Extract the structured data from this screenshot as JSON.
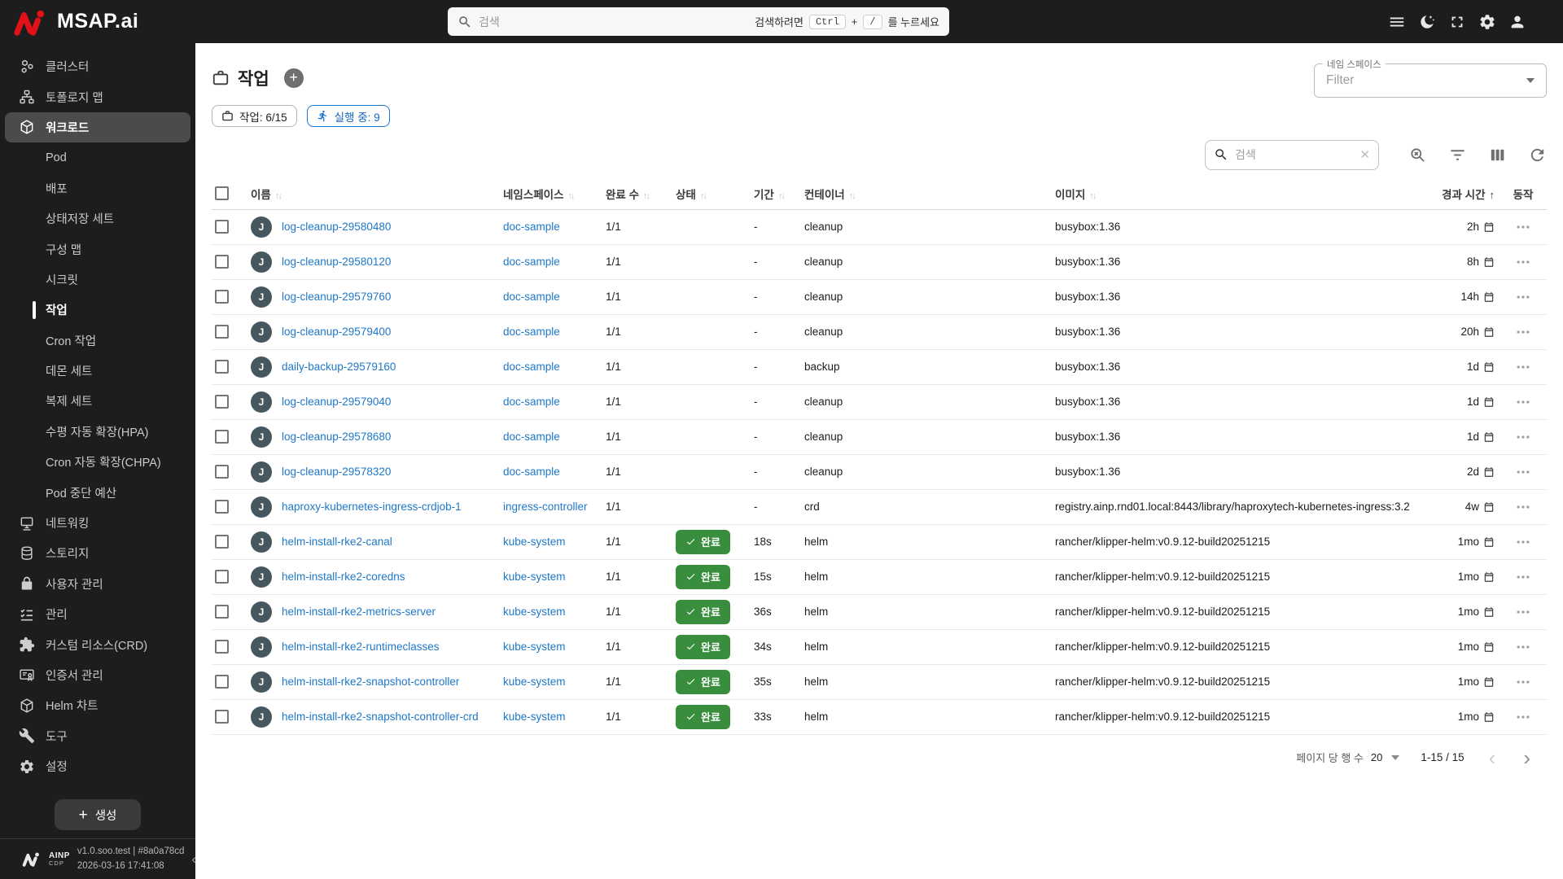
{
  "topbar": {
    "brand": "MSAP.ai",
    "search": {
      "placeholder": "검색",
      "hint_prefix": "검색하려면",
      "key1": "Ctrl",
      "key_join": "+",
      "key2": "/",
      "hint_suffix": "를 누르세요"
    },
    "actions": [
      {
        "id": "menu",
        "icon": "menu-icon"
      },
      {
        "id": "dark-mode",
        "icon": "moon-icon"
      },
      {
        "id": "fullscreen",
        "icon": "fullscreen-icon"
      },
      {
        "id": "settings",
        "icon": "gear-icon"
      },
      {
        "id": "account",
        "icon": "person-icon"
      }
    ]
  },
  "sidebar": {
    "items": [
      {
        "id": "cluster",
        "label": "클러스터",
        "icon": "cluster"
      },
      {
        "id": "topology-map",
        "label": "토폴로지 맵",
        "icon": "topology"
      },
      {
        "id": "workload",
        "label": "워크로드",
        "icon": "workload",
        "selected": true
      },
      {
        "id": "pod",
        "label": "Pod",
        "sub": true
      },
      {
        "id": "deployment",
        "label": "배포",
        "sub": true
      },
      {
        "id": "statefulset",
        "label": "상태저장 세트",
        "sub": true
      },
      {
        "id": "configmap",
        "label": "구성 맵",
        "sub": true
      },
      {
        "id": "secret",
        "label": "시크릿",
        "sub": true
      },
      {
        "id": "job",
        "label": "작업",
        "sub": true,
        "active": true
      },
      {
        "id": "cronjob",
        "label": "Cron 작업",
        "sub": true
      },
      {
        "id": "daemonset",
        "label": "데몬 세트",
        "sub": true
      },
      {
        "id": "replicaset",
        "label": "복제 세트",
        "sub": true
      },
      {
        "id": "hpa",
        "label": "수평 자동 확장(HPA)",
        "sub": true
      },
      {
        "id": "chpa",
        "label": "Cron 자동 확장(CHPA)",
        "sub": true
      },
      {
        "id": "pdb",
        "label": "Pod 중단 예산",
        "sub": true
      },
      {
        "id": "networking",
        "label": "네트워킹",
        "icon": "network"
      },
      {
        "id": "storage",
        "label": "스토리지",
        "icon": "storage"
      },
      {
        "id": "user-management",
        "label": "사용자 관리",
        "icon": "lock"
      },
      {
        "id": "management",
        "label": "관리",
        "icon": "checklist"
      },
      {
        "id": "custom-resource-crd",
        "label": "커스텀 리소스(CRD)",
        "icon": "puzzle"
      },
      {
        "id": "certificate-management",
        "label": "인증서 관리",
        "icon": "certificate"
      },
      {
        "id": "helm-chart",
        "label": "Helm 차트",
        "icon": "helm"
      },
      {
        "id": "tools",
        "label": "도구",
        "icon": "tools"
      },
      {
        "id": "settings",
        "label": "설정",
        "icon": "gear"
      }
    ],
    "create_label": "생성",
    "footer": {
      "brand": "AINP",
      "brand_sub": "CDP",
      "version": "v1.0.soo.test | #8a0a78cd",
      "timestamp": "2026-03-16 17:41:08"
    }
  },
  "main": {
    "title": "작업",
    "namespace_filter": {
      "label": "네임 스페이스",
      "value": "Filter"
    },
    "chips": {
      "jobs": "작업: 6/15",
      "running": "실행 중: 9"
    },
    "table_search_placeholder": "검색",
    "toolbar_icons": [
      {
        "id": "search-off"
      },
      {
        "id": "filter"
      },
      {
        "id": "columns"
      },
      {
        "id": "refresh"
      }
    ],
    "table": {
      "columns": [
        {
          "label": "이름",
          "sort": "both"
        },
        {
          "label": "네임스페이스",
          "sort": "both"
        },
        {
          "label": "완료 수",
          "sort": "both"
        },
        {
          "label": "상태",
          "sort": "both"
        },
        {
          "label": "기간",
          "sort": "both"
        },
        {
          "label": "컨테이너",
          "sort": "both"
        },
        {
          "label": "이미지",
          "sort": "both"
        },
        {
          "label": "경과 시간",
          "sort": "asc"
        },
        {
          "label": "동작",
          "sort": "none"
        }
      ],
      "status_done_label": "완료",
      "rows": [
        {
          "avatar": "J",
          "name": "log-cleanup-29580480",
          "namespace": "doc-sample",
          "completions": "1/1",
          "status": "",
          "duration": "-",
          "container": "cleanup",
          "image": "busybox:1.36",
          "elapsed": "2h"
        },
        {
          "avatar": "J",
          "name": "log-cleanup-29580120",
          "namespace": "doc-sample",
          "completions": "1/1",
          "status": "",
          "duration": "-",
          "container": "cleanup",
          "image": "busybox:1.36",
          "elapsed": "8h"
        },
        {
          "avatar": "J",
          "name": "log-cleanup-29579760",
          "namespace": "doc-sample",
          "completions": "1/1",
          "status": "",
          "duration": "-",
          "container": "cleanup",
          "image": "busybox:1.36",
          "elapsed": "14h"
        },
        {
          "avatar": "J",
          "name": "log-cleanup-29579400",
          "namespace": "doc-sample",
          "completions": "1/1",
          "status": "",
          "duration": "-",
          "container": "cleanup",
          "image": "busybox:1.36",
          "elapsed": "20h"
        },
        {
          "avatar": "J",
          "name": "daily-backup-29579160",
          "namespace": "doc-sample",
          "completions": "1/1",
          "status": "",
          "duration": "-",
          "container": "backup",
          "image": "busybox:1.36",
          "elapsed": "1d"
        },
        {
          "avatar": "J",
          "name": "log-cleanup-29579040",
          "namespace": "doc-sample",
          "completions": "1/1",
          "status": "",
          "duration": "-",
          "container": "cleanup",
          "image": "busybox:1.36",
          "elapsed": "1d"
        },
        {
          "avatar": "J",
          "name": "log-cleanup-29578680",
          "namespace": "doc-sample",
          "completions": "1/1",
          "status": "",
          "duration": "-",
          "container": "cleanup",
          "image": "busybox:1.36",
          "elapsed": "1d"
        },
        {
          "avatar": "J",
          "name": "log-cleanup-29578320",
          "namespace": "doc-sample",
          "completions": "1/1",
          "status": "",
          "duration": "-",
          "container": "cleanup",
          "image": "busybox:1.36",
          "elapsed": "2d"
        },
        {
          "avatar": "J",
          "name": "haproxy-kubernetes-ingress-crdjob-1",
          "namespace": "ingress-controller",
          "completions": "1/1",
          "status": "",
          "duration": "-",
          "container": "crd",
          "image": "registry.ainp.rnd01.local:8443/library/haproxytech-kubernetes-ingress:3.2",
          "elapsed": "4w"
        },
        {
          "avatar": "J",
          "name": "helm-install-rke2-canal",
          "namespace": "kube-system",
          "completions": "1/1",
          "status": "완료",
          "duration": "18s",
          "container": "helm",
          "image": "rancher/klipper-helm:v0.9.12-build20251215",
          "elapsed": "1mo"
        },
        {
          "avatar": "J",
          "name": "helm-install-rke2-coredns",
          "namespace": "kube-system",
          "completions": "1/1",
          "status": "완료",
          "duration": "15s",
          "container": "helm",
          "image": "rancher/klipper-helm:v0.9.12-build20251215",
          "elapsed": "1mo"
        },
        {
          "avatar": "J",
          "name": "helm-install-rke2-metrics-server",
          "namespace": "kube-system",
          "completions": "1/1",
          "status": "완료",
          "duration": "36s",
          "container": "helm",
          "image": "rancher/klipper-helm:v0.9.12-build20251215",
          "elapsed": "1mo"
        },
        {
          "avatar": "J",
          "name": "helm-install-rke2-runtimeclasses",
          "namespace": "kube-system",
          "completions": "1/1",
          "status": "완료",
          "duration": "34s",
          "container": "helm",
          "image": "rancher/klipper-helm:v0.9.12-build20251215",
          "elapsed": "1mo"
        },
        {
          "avatar": "J",
          "name": "helm-install-rke2-snapshot-controller",
          "namespace": "kube-system",
          "completions": "1/1",
          "status": "완료",
          "duration": "35s",
          "container": "helm",
          "image": "rancher/klipper-helm:v0.9.12-build20251215",
          "elapsed": "1mo"
        },
        {
          "avatar": "J",
          "name": "helm-install-rke2-snapshot-controller-crd",
          "namespace": "kube-system",
          "completions": "1/1",
          "status": "완료",
          "duration": "33s",
          "container": "helm",
          "image": "rancher/klipper-helm:v0.9.12-build20251215",
          "elapsed": "1mo"
        }
      ]
    },
    "pagination": {
      "rows_label": "페이지 당 행 수",
      "rows_value": "20",
      "range": "1-15 / 15"
    }
  },
  "colors": {
    "brand_red": "#e01119",
    "link_blue": "#1e78c8",
    "chip_blue": "#1976d2",
    "badge_green": "#388e3c",
    "dark_bg": "#1d1d1d"
  }
}
